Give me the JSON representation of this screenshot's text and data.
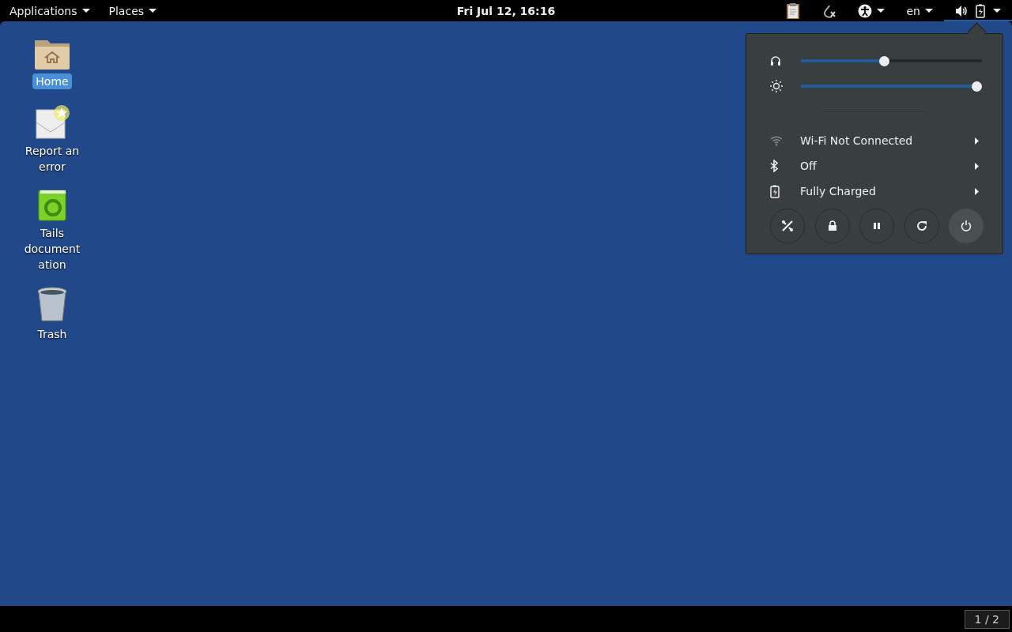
{
  "top_bar": {
    "menus": [
      {
        "label": "Applications"
      },
      {
        "label": "Places"
      }
    ],
    "clock": "Fri Jul 12, 16:16",
    "tray": [
      {
        "kind": "clipboard",
        "caret": false
      },
      {
        "kind": "onion",
        "caret": false
      },
      {
        "kind": "accessibility",
        "caret": true
      },
      {
        "kind": "language",
        "label": "en",
        "caret": true
      },
      {
        "kind": "system",
        "caret": true,
        "open": true
      }
    ]
  },
  "desktop_icons": [
    {
      "kind": "home",
      "label": "Home",
      "selected": true
    },
    {
      "kind": "report",
      "label": "Report an error",
      "selected": false
    },
    {
      "kind": "docs",
      "label": "Tails documentation",
      "selected": false
    },
    {
      "kind": "trash",
      "label": "Trash",
      "selected": false
    }
  ],
  "system_menu": {
    "sliders": [
      {
        "kind": "headphones",
        "level": 0.46
      },
      {
        "kind": "brightness",
        "level": 1.0
      }
    ],
    "items": [
      {
        "kind": "wifi",
        "label": "Wi-Fi Not Connected"
      },
      {
        "kind": "bluetooth",
        "label": "Off"
      },
      {
        "kind": "battery",
        "label": "Fully Charged"
      }
    ],
    "buttons": [
      {
        "kind": "settings",
        "highlighted": false
      },
      {
        "kind": "lock",
        "highlighted": false
      },
      {
        "kind": "suspend",
        "highlighted": false
      },
      {
        "kind": "restart",
        "highlighted": false
      },
      {
        "kind": "power",
        "highlighted": true
      }
    ]
  },
  "bottom_bar": {
    "workspace": "1 / 2"
  }
}
